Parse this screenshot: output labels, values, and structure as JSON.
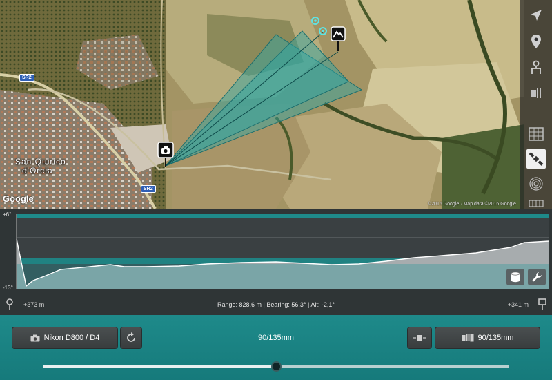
{
  "map": {
    "town_label_line1": "San Quirico",
    "town_label_line2": "d'Orcia",
    "road_badge_1": "SR2",
    "road_badge_2": "SR2",
    "provider_logo": "Google",
    "copyright": "©2016 Google · Map data ©2016 Google",
    "markers": {
      "camera": "camera-pin-icon",
      "subject": "mountain-pin-icon",
      "target_1": "target-ring-icon",
      "target_2": "target-ring-icon"
    }
  },
  "map_tools": [
    {
      "icon": "navigation-arrow-icon"
    },
    {
      "icon": "location-pin-icon"
    },
    {
      "icon": "dual-pin-icon"
    },
    {
      "icon": "rangefinder-icon"
    },
    {
      "icon": "map-grid-icon"
    },
    {
      "icon": "satellite-icon"
    },
    {
      "icon": "terrain-icon"
    },
    {
      "icon": "more-layers-icon"
    }
  ],
  "profile": {
    "top_label": "+6°",
    "bottom_label": "-13°",
    "elevation_profile": {
      "note_units": "degrees",
      "ylim": [
        -13,
        6
      ]
    },
    "buttons": {
      "cylinder": "cylinder-icon",
      "settings": "wrench-icon"
    }
  },
  "info": {
    "alt_left": "+373 m",
    "alt_right": "+341 m",
    "range_text": "Range: 828,6 m | Bearing: 56,3° | Alt: -2,1°"
  },
  "controls": {
    "camera_label": "Nikon D800 / D4",
    "focal_center": "90/135mm",
    "lens_label": "90/135mm",
    "slider_value": 0.5
  },
  "colors": {
    "accent": "#1e8a8a",
    "fov": "#2aa6a6"
  }
}
